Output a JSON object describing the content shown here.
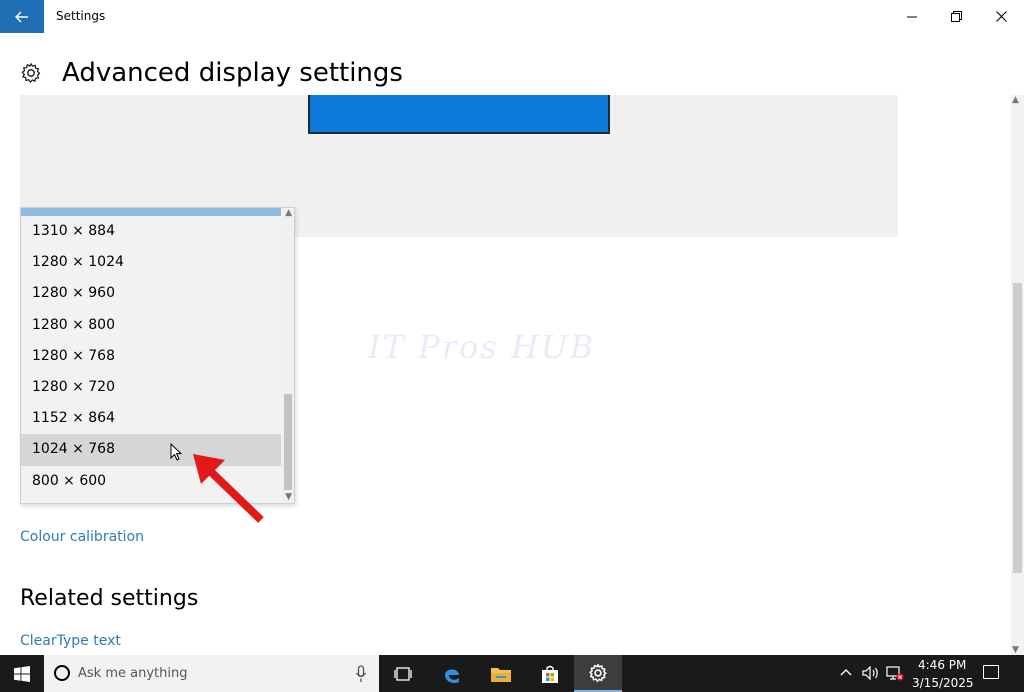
{
  "window": {
    "title": "Settings",
    "minimize": "—",
    "maximize": "❐",
    "close": "✕"
  },
  "page": {
    "title": "Advanced display settings"
  },
  "watermark": "IT Pros HUB",
  "resolution_dropdown": {
    "options": [
      "1310 × 884",
      "1280 × 1024",
      "1280 × 960",
      "1280 × 800",
      "1280 × 768",
      "1280 × 720",
      "1152 × 864",
      "1024 × 768",
      "800 × 600"
    ],
    "highlighted": "1024 × 768"
  },
  "links": {
    "colour_calibration": "Colour calibration",
    "cleartype": "ClearType text"
  },
  "related": {
    "title": "Related settings"
  },
  "taskbar": {
    "search_placeholder": "Ask me anything",
    "time": "4:46 PM",
    "date": "3/15/2025"
  },
  "colors": {
    "accent": "#1f6db3",
    "link": "#2f7bb8",
    "monitor": "#0c78d7",
    "arrow": "#e11919"
  }
}
